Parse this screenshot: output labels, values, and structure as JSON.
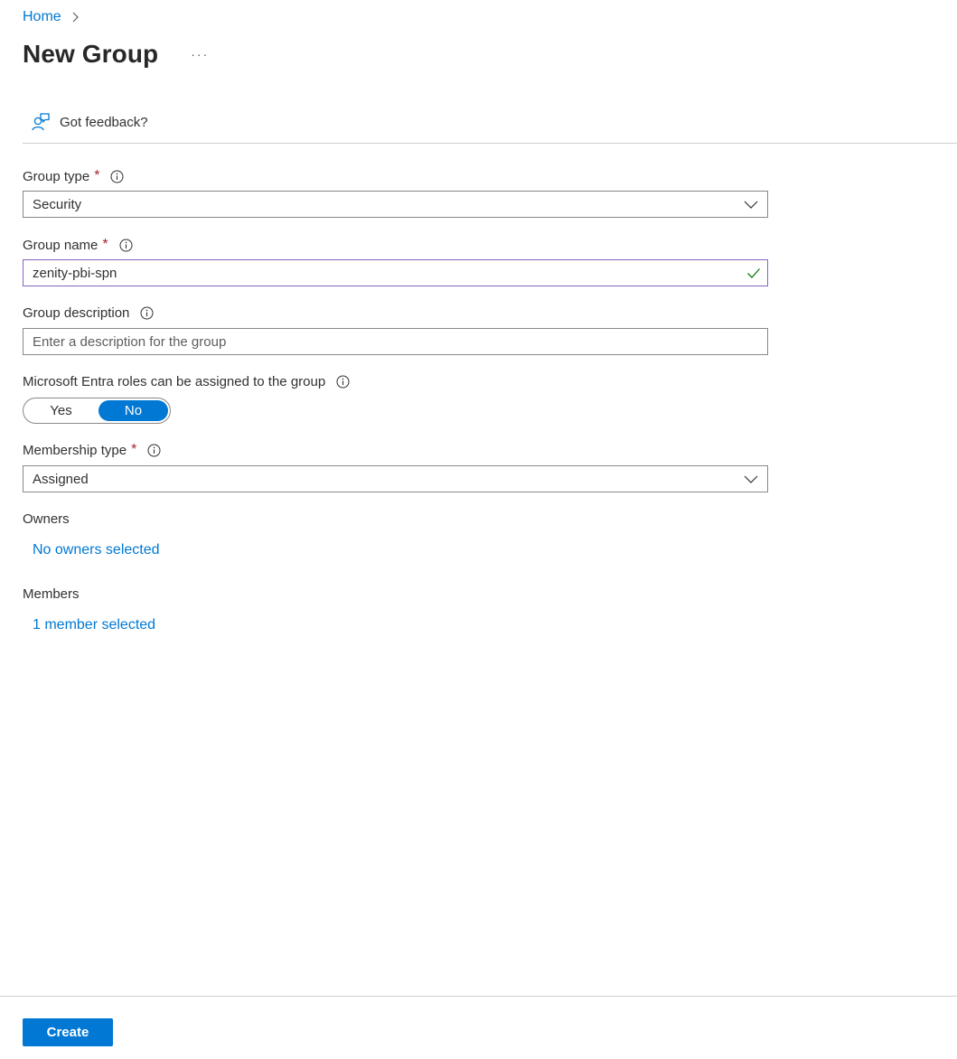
{
  "breadcrumb": {
    "home": "Home"
  },
  "page": {
    "title": "New Group",
    "more": "···"
  },
  "toolbar": {
    "feedback": "Got feedback?"
  },
  "form": {
    "group_type": {
      "label": "Group type",
      "required": "*",
      "value": "Security"
    },
    "group_name": {
      "label": "Group name",
      "required": "*",
      "value": "zenity-pbi-spn"
    },
    "group_description": {
      "label": "Group description",
      "placeholder": "Enter a description for the group",
      "value": ""
    },
    "entra_roles": {
      "label": "Microsoft Entra roles can be assigned to the group",
      "yes": "Yes",
      "no": "No",
      "selected": "No"
    },
    "membership_type": {
      "label": "Membership type",
      "required": "*",
      "value": "Assigned"
    },
    "owners": {
      "label": "Owners",
      "link": "No owners selected"
    },
    "members": {
      "label": "Members",
      "link": "1 member selected"
    }
  },
  "footer": {
    "create": "Create"
  },
  "colors": {
    "accent": "#0078d4",
    "required": "#a4262c",
    "focus": "#8661c5",
    "valid": "#107c10"
  }
}
